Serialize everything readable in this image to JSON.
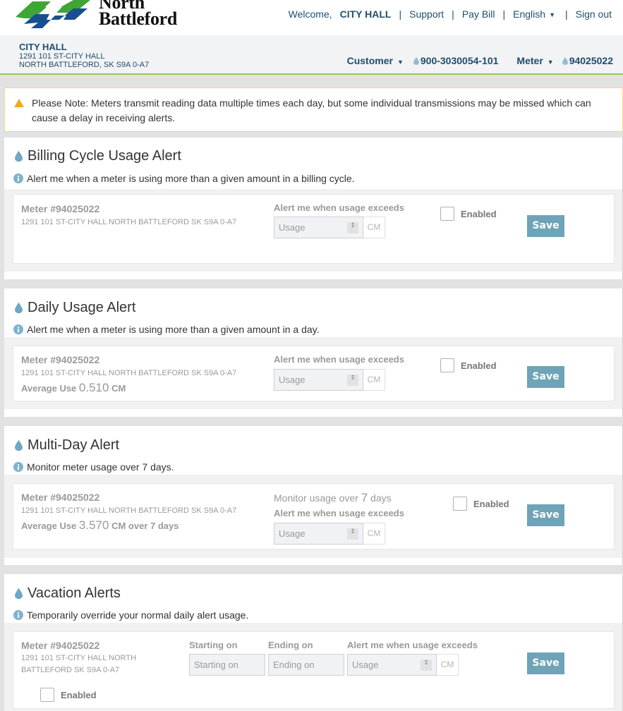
{
  "brand": {
    "name_line1": "North",
    "name_line2": "Battleford",
    "logo_colors": {
      "green": "#3fa535",
      "blue": "#184f8f"
    }
  },
  "topnav": {
    "welcome": "Welcome,",
    "user_name": "CITY HALL",
    "support": "Support",
    "pay_bill": "Pay Bill",
    "language": "English",
    "sign_out": "Sign out",
    "separator": "|"
  },
  "account": {
    "name": "CITY HALL",
    "address_line1": "1291 101 ST-CITY HALL",
    "address_line2": "NORTH BATTLEFORD, SK S9A 0-A7",
    "customer_label": "Customer",
    "customer_number": "900-3030054-101",
    "meter_label": "Meter",
    "meter_number": "94025022",
    "caret": "▼"
  },
  "note": {
    "icon": "warning-triangle-icon",
    "text": "Please Note: Meters transmit reading data multiple times each day, but some individual transmissions may be missed which can cause a delay in receiving alerts."
  },
  "colors": {
    "accent_blue": "#6fa3b8",
    "nav_text": "#20506e",
    "green_rule": "#8dcc5a",
    "warning": "#f5a623"
  },
  "sections": {
    "billing": {
      "title": "Billing Cycle Usage Alert",
      "description": "Alert me when a meter is using more than a given amount in a billing cycle.",
      "meter": "Meter #94025022",
      "address": "1291 101 ST-CITY HALL NORTH BATTLEFORD SK S9A 0-A7",
      "exceeds_label": "Alert me when usage exceeds",
      "usage_placeholder": "Usage",
      "unit": "CM",
      "enabled_label": "Enabled",
      "enabled": false,
      "save": "Save"
    },
    "daily": {
      "title": "Daily Usage Alert",
      "description": "Alert me when a meter is using more than a given amount in a day.",
      "meter": "Meter #94025022",
      "address": "1291 101 ST-CITY HALL NORTH BATTLEFORD SK S9A 0-A7",
      "avg_label": "Average Use",
      "avg_value": "0.510",
      "avg_unit": "CM",
      "exceeds_label": "Alert me when usage exceeds",
      "usage_placeholder": "Usage",
      "unit": "CM",
      "enabled_label": "Enabled",
      "enabled": false,
      "save": "Save"
    },
    "multiday": {
      "title": "Multi-Day Alert",
      "description": "Monitor meter usage over 7 days.",
      "meter": "Meter #94025022",
      "address": "1291 101 ST-CITY HALL NORTH BATTLEFORD SK S9A 0-A7",
      "avg_label": "Average Use",
      "avg_value": "3.570",
      "avg_suffix": "CM over 7 days",
      "monitor_prefix": "Monitor usage over",
      "monitor_days": "7",
      "monitor_suffix": "days",
      "exceeds_label": "Alert me when usage exceeds",
      "usage_placeholder": "Usage",
      "unit": "CM",
      "enabled_label": "Enabled",
      "enabled": false,
      "save": "Save"
    },
    "vacation": {
      "title": "Vacation Alerts",
      "description": "Temporarily override your normal daily alert usage.",
      "meter": "Meter #94025022",
      "address": "1291 101 ST-CITY HALL NORTH BATTLEFORD SK S9A 0-A7",
      "start_label": "Starting on",
      "start_placeholder": "Starting on",
      "end_label": "Ending on",
      "end_placeholder": "Ending on",
      "exceeds_label": "Alert me when usage exceeds",
      "usage_placeholder": "Usage",
      "unit": "CM",
      "enabled_label": "Enabled",
      "enabled": false,
      "save": "Save"
    }
  },
  "icons": {
    "spinner": "⇕"
  }
}
